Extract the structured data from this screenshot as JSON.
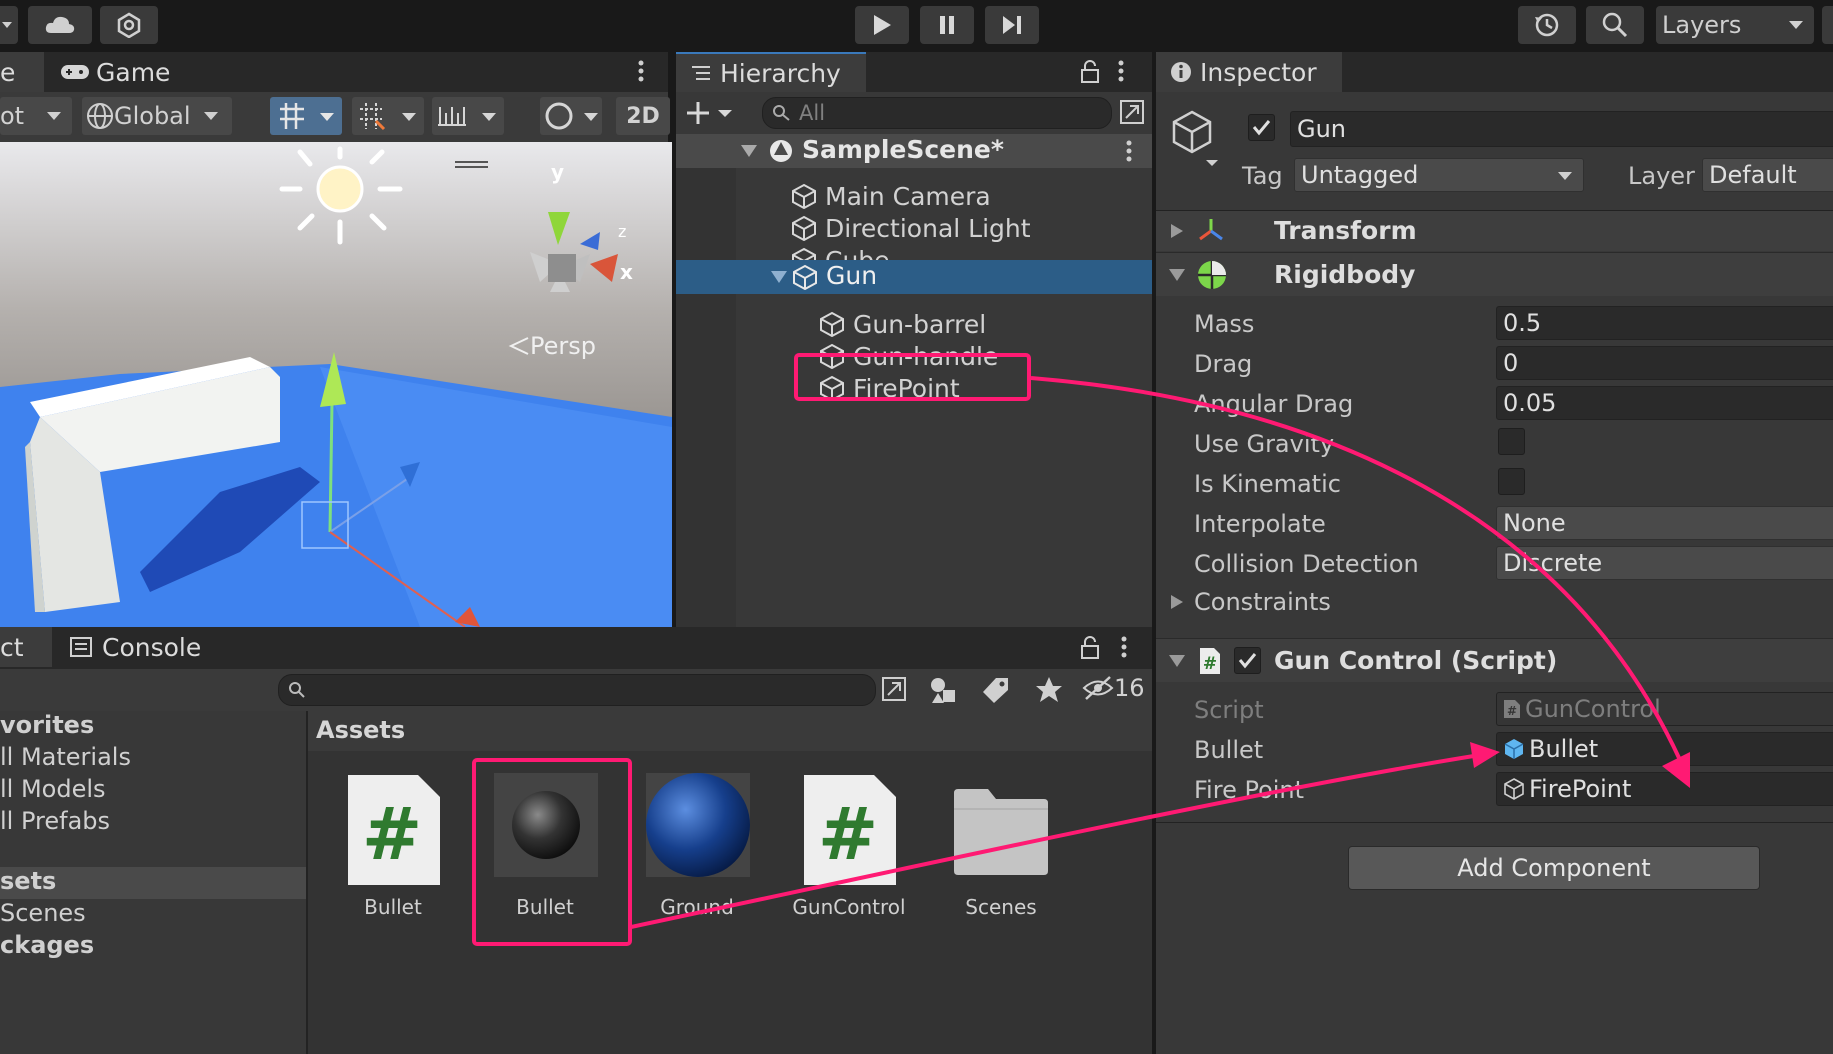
{
  "toolbar": {
    "layers_label": "Layers",
    "play_icon": "play-icon",
    "pause_icon": "pause-icon",
    "step_icon": "step-icon"
  },
  "scene": {
    "tab_game": "Game",
    "tab_partial": "e",
    "pivot_partial": "ot",
    "global_label": "Global",
    "mode_2d": "2D",
    "persp_label": "Persp",
    "axis_y": "y",
    "axis_x": "x",
    "axis_z": "z"
  },
  "hierarchy": {
    "tab_label": "Hierarchy",
    "search_placeholder": "All",
    "scene_name": "SampleScene*",
    "items": [
      {
        "label": "Main Camera"
      },
      {
        "label": "Directional Light"
      },
      {
        "label": "Cube"
      },
      {
        "label": "Gun"
      },
      {
        "label": "Gun-barrel"
      },
      {
        "label": "Gun-handle"
      },
      {
        "label": "FirePoint"
      }
    ]
  },
  "inspector": {
    "tab_label": "Inspector",
    "object_name": "Gun",
    "tag_label": "Tag",
    "tag_value": "Untagged",
    "layer_label": "Layer",
    "layer_value": "Default",
    "transform_label": "Transform",
    "rigidbody_label": "Rigidbody",
    "rigidbody_fields": [
      {
        "label": "Mass",
        "value": "0.5"
      },
      {
        "label": "Drag",
        "value": "0"
      },
      {
        "label": "Angular Drag",
        "value": "0.05"
      },
      {
        "label": "Use Gravity",
        "value": ""
      },
      {
        "label": "Is Kinematic",
        "value": ""
      },
      {
        "label": "Interpolate",
        "value": "None"
      },
      {
        "label": "Collision Detection",
        "value": "Discrete"
      }
    ],
    "constraints_label": "Constraints",
    "script_component_label": "Gun Control (Script)",
    "script_label": "Script",
    "script_value": "GunControl",
    "bullet_label": "Bullet",
    "bullet_value": "Bullet",
    "firepoint_label": "Fire Point",
    "firepoint_value": "FirePoint",
    "add_component": "Add Component"
  },
  "project": {
    "tab_partial": "ct",
    "console_tab": "Console",
    "hidden_count": "16",
    "favorites": [
      "vorites",
      "ll Materials",
      "ll Models",
      "ll Prefabs"
    ],
    "assets_root": "sets",
    "assets_children": [
      "Scenes",
      "ckages"
    ],
    "assets_header": "Assets",
    "assets": [
      {
        "label": "Bullet",
        "icon": "script-icon"
      },
      {
        "label": "Bullet",
        "icon": "black-sphere-icon"
      },
      {
        "label": "Ground",
        "icon": "blue-sphere-icon"
      },
      {
        "label": "GunControl",
        "icon": "script-icon"
      },
      {
        "label": "Scenes",
        "icon": "folder-icon"
      }
    ]
  },
  "colors": {
    "highlight": "#ff1a73",
    "selection": "#2c5d87",
    "script_green": "#2f7a2f"
  }
}
